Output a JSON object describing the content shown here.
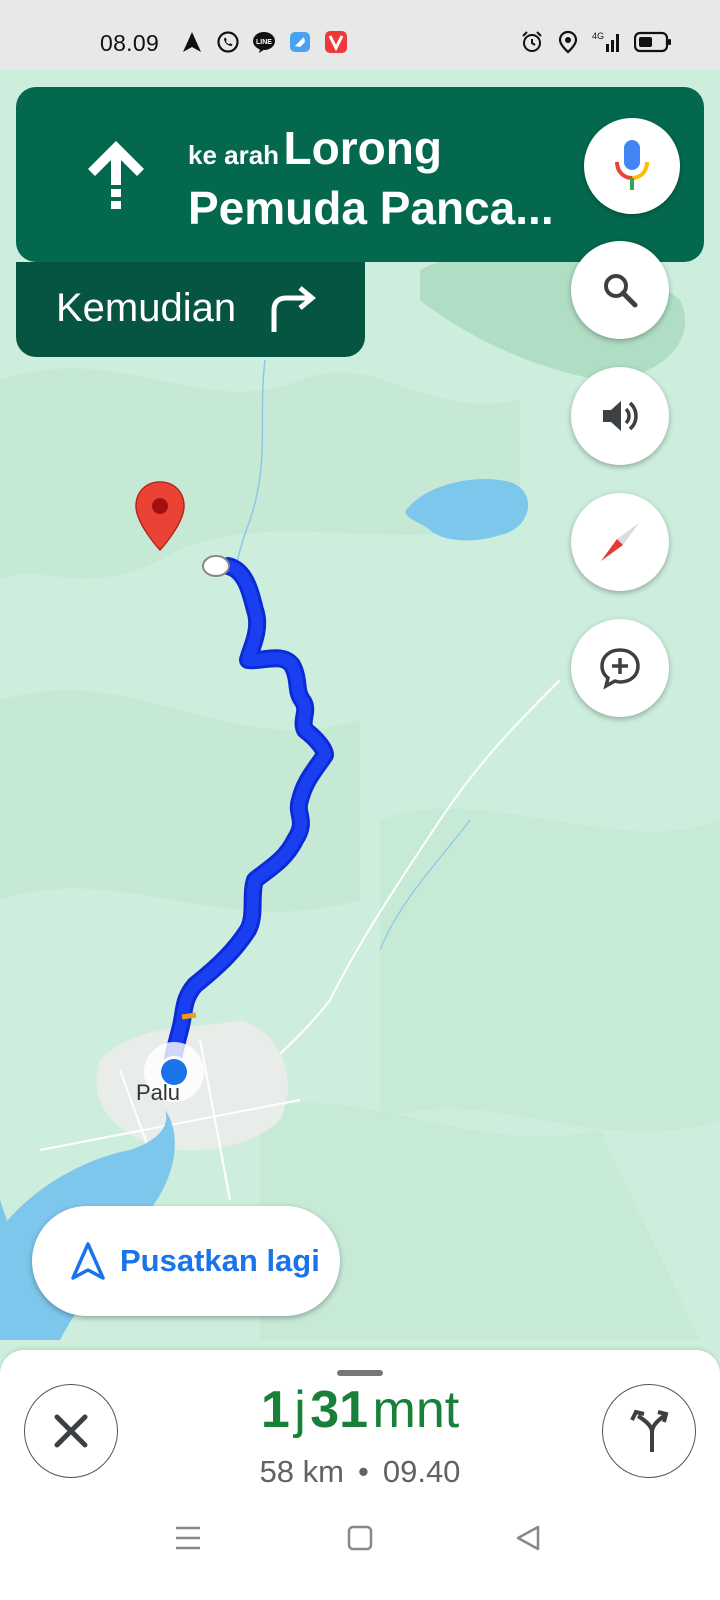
{
  "status_bar": {
    "time": "08.09",
    "network": "4G",
    "left_icons": [
      "navigation-arrow-icon",
      "whatsapp-icon",
      "line-icon",
      "app-icon",
      "vivaldi-icon"
    ],
    "right_icons": [
      "alarm-icon",
      "location-icon",
      "signal-icon",
      "battery-icon"
    ]
  },
  "direction": {
    "prefix": "ke arah",
    "street_line1": "Lorong",
    "street_line2": "Pemuda Panca...",
    "maneuver_icon": "straight-arrow-icon"
  },
  "next_step": {
    "label": "Kemudian",
    "turn_icon": "turn-right-icon"
  },
  "map": {
    "city_label": "Palu",
    "route_color": "#1a3ff0",
    "water_color": "#7dc7ec",
    "land_color": "#cdeedd"
  },
  "map_controls": [
    "search-icon",
    "volume-icon",
    "compass-icon",
    "add-report-icon"
  ],
  "recenter": {
    "label": "Pusatkan lagi"
  },
  "trip": {
    "hours": "1",
    "hours_unit": "j",
    "minutes": "31",
    "minutes_unit": "mnt",
    "distance": "58 km",
    "separator": "•",
    "arrival": "09.40"
  },
  "colors": {
    "banner": "#04684e",
    "banner_secondary": "#055542",
    "eta_green": "#188038",
    "accent_blue": "#1a73e8"
  }
}
